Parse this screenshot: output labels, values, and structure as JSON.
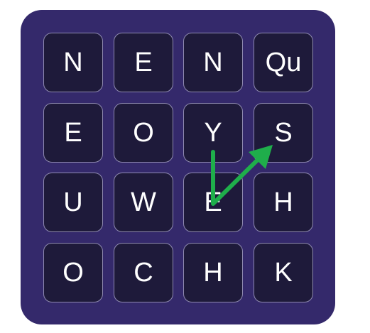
{
  "board": {
    "rows": [
      [
        "N",
        "E",
        "N",
        "Qu"
      ],
      [
        "E",
        "O",
        "Y",
        "S"
      ],
      [
        "U",
        "W",
        "E",
        "H"
      ],
      [
        "O",
        "C",
        "H",
        "K"
      ]
    ]
  },
  "path": {
    "color": "#1fae4b",
    "cells": [
      [
        1,
        2
      ],
      [
        2,
        2
      ],
      [
        1,
        3
      ]
    ],
    "arrow_end": "S"
  },
  "colors": {
    "board_bg": "#34296b",
    "tile_bg": "#1e1a3a",
    "tile_border": "#8f8ab0",
    "letter": "#ffffff"
  }
}
